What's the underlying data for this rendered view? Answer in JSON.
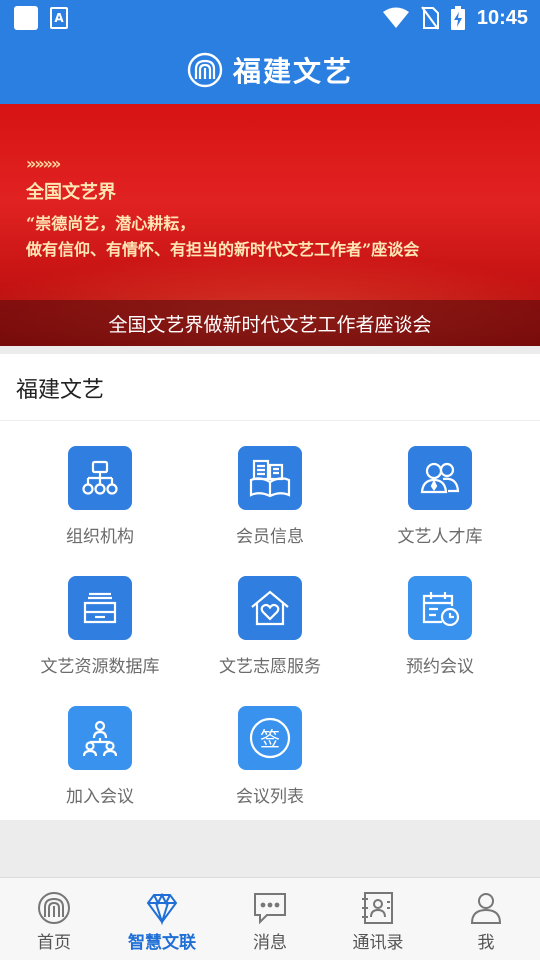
{
  "status_bar": {
    "time": "10:45"
  },
  "header": {
    "title": "福建文艺"
  },
  "banner": {
    "arrows": "»»»»",
    "heading": "全国文艺界",
    "line1": "“崇德尚艺，潜心耕耘，",
    "line2": "做有信仰、有情怀、有担当的新时代文艺工作者”座谈会",
    "caption": "全国文艺界做新时代文艺工作者座谈会"
  },
  "section": {
    "title": "福建文艺",
    "tiles": [
      {
        "label": "组织机构",
        "icon": "org-chart-icon"
      },
      {
        "label": "会员信息",
        "icon": "member-info-icon"
      },
      {
        "label": "文艺人才库",
        "icon": "talent-pool-icon"
      },
      {
        "label": "文艺资源数据库",
        "icon": "resource-database-icon"
      },
      {
        "label": "文艺志愿服务",
        "icon": "volunteer-house-icon"
      },
      {
        "label": "预约会议",
        "icon": "calendar-clock-icon"
      },
      {
        "label": "加入会议",
        "icon": "join-meeting-icon"
      },
      {
        "label": "会议列表",
        "icon": "sign-badge-icon",
        "glyph": "签"
      }
    ]
  },
  "bottom_nav": [
    {
      "label": "首页",
      "icon": "home-logo-icon"
    },
    {
      "label": "智慧文联",
      "icon": "diamond-icon",
      "active": true
    },
    {
      "label": "消息",
      "icon": "message-bubble-icon"
    },
    {
      "label": "通讯录",
      "icon": "contacts-icon"
    },
    {
      "label": "我",
      "icon": "profile-icon"
    }
  ],
  "colors": {
    "brand_blue": "#2b7fe0",
    "banner_red": "#d71313",
    "active_nav": "#1f6fd6"
  }
}
